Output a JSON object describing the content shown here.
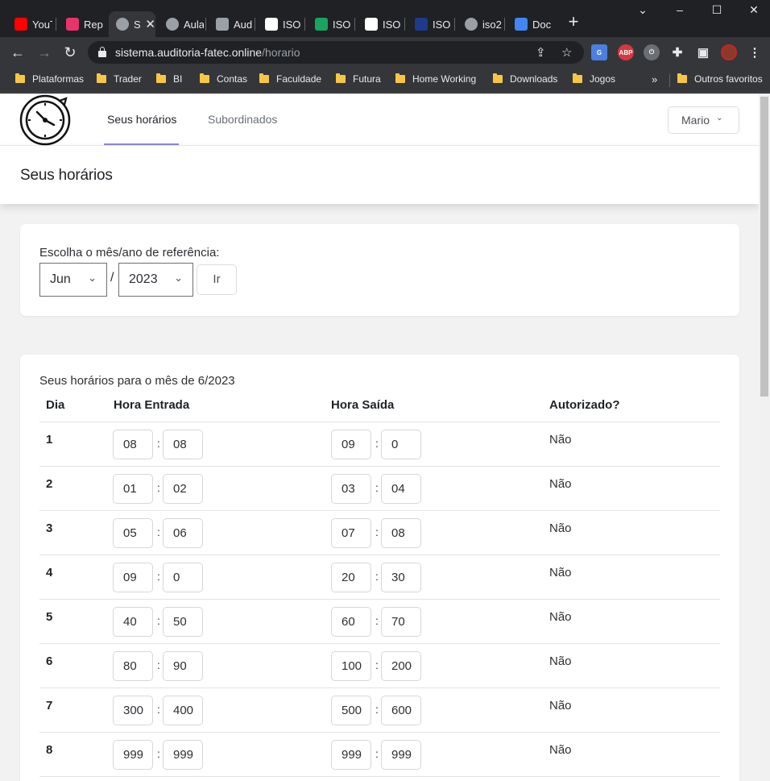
{
  "browser": {
    "tabs": [
      {
        "title": "YouTube",
        "icon": "youtube-icon",
        "color": "#ff0000"
      },
      {
        "title": "Rep",
        "icon": "play-icon",
        "color": "#e8336d"
      },
      {
        "title": "S",
        "icon": "globe-icon",
        "color": "#9aa0a6"
      },
      {
        "title": "Aula",
        "icon": "globe-icon",
        "color": "#9aa0a6"
      },
      {
        "title": "Aud",
        "icon": "openai-icon",
        "color": "#9aa0a6"
      },
      {
        "title": "ISO",
        "icon": "google-icon",
        "color": "#ffffff"
      },
      {
        "title": "ISO",
        "icon": "leaf-icon",
        "color": "#1aa260"
      },
      {
        "title": "ISO",
        "icon": "wikipedia-icon",
        "color": "#ffffff"
      },
      {
        "title": "ISO",
        "icon": "zs-icon",
        "color": "#1e3a8a"
      },
      {
        "title": "iso2",
        "icon": "globe-icon",
        "color": "#9aa0a6"
      },
      {
        "title": "Doc",
        "icon": "docs-icon",
        "color": "#4285f4"
      }
    ],
    "url_host": "sistema.auditoria-fatec.online",
    "url_path": "/horario",
    "bookmarks": [
      "Plataformas",
      "Trader",
      "BI",
      "Contas",
      "Faculdade",
      "Futura",
      "Home Working",
      "Downloads",
      "Jogos"
    ],
    "bookmarks_overflow": "»",
    "other_bookmarks": "Outros favoritos",
    "extensions": {
      "abp": "ABP"
    }
  },
  "app": {
    "nav": {
      "tab_mine": "Seus horários",
      "tab_subordinates": "Subordinados",
      "user": "Mario"
    },
    "page_title": "Seus horários",
    "filter": {
      "label": "Escolha o mês/ano de referência:",
      "month": "Jun",
      "separator": "/",
      "year": "2023",
      "go_label": "Ir"
    },
    "schedule": {
      "caption": "Seus horários para o mês de 6/2023",
      "columns": {
        "day": "Dia",
        "entry": "Hora Entrada",
        "exit": "Hora Saída",
        "authorized": "Autorizado?"
      },
      "rows": [
        {
          "day": "1",
          "in_h": "08",
          "in_m": "08",
          "out_h": "09",
          "out_m": "0",
          "auth": "Não"
        },
        {
          "day": "2",
          "in_h": "01",
          "in_m": "02",
          "out_h": "03",
          "out_m": "04",
          "auth": "Não"
        },
        {
          "day": "3",
          "in_h": "05",
          "in_m": "06",
          "out_h": "07",
          "out_m": "08",
          "auth": "Não"
        },
        {
          "day": "4",
          "in_h": "09",
          "in_m": "0",
          "out_h": "20",
          "out_m": "30",
          "auth": "Não"
        },
        {
          "day": "5",
          "in_h": "40",
          "in_m": "50",
          "out_h": "60",
          "out_m": "70",
          "auth": "Não"
        },
        {
          "day": "6",
          "in_h": "80",
          "in_m": "90",
          "out_h": "100",
          "out_m": "200",
          "auth": "Não"
        },
        {
          "day": "7",
          "in_h": "300",
          "in_m": "400",
          "out_h": "500",
          "out_m": "600",
          "auth": "Não"
        },
        {
          "day": "8",
          "in_h": "999",
          "in_m": "999",
          "out_h": "999",
          "out_m": "999",
          "auth": "Não"
        }
      ]
    }
  }
}
